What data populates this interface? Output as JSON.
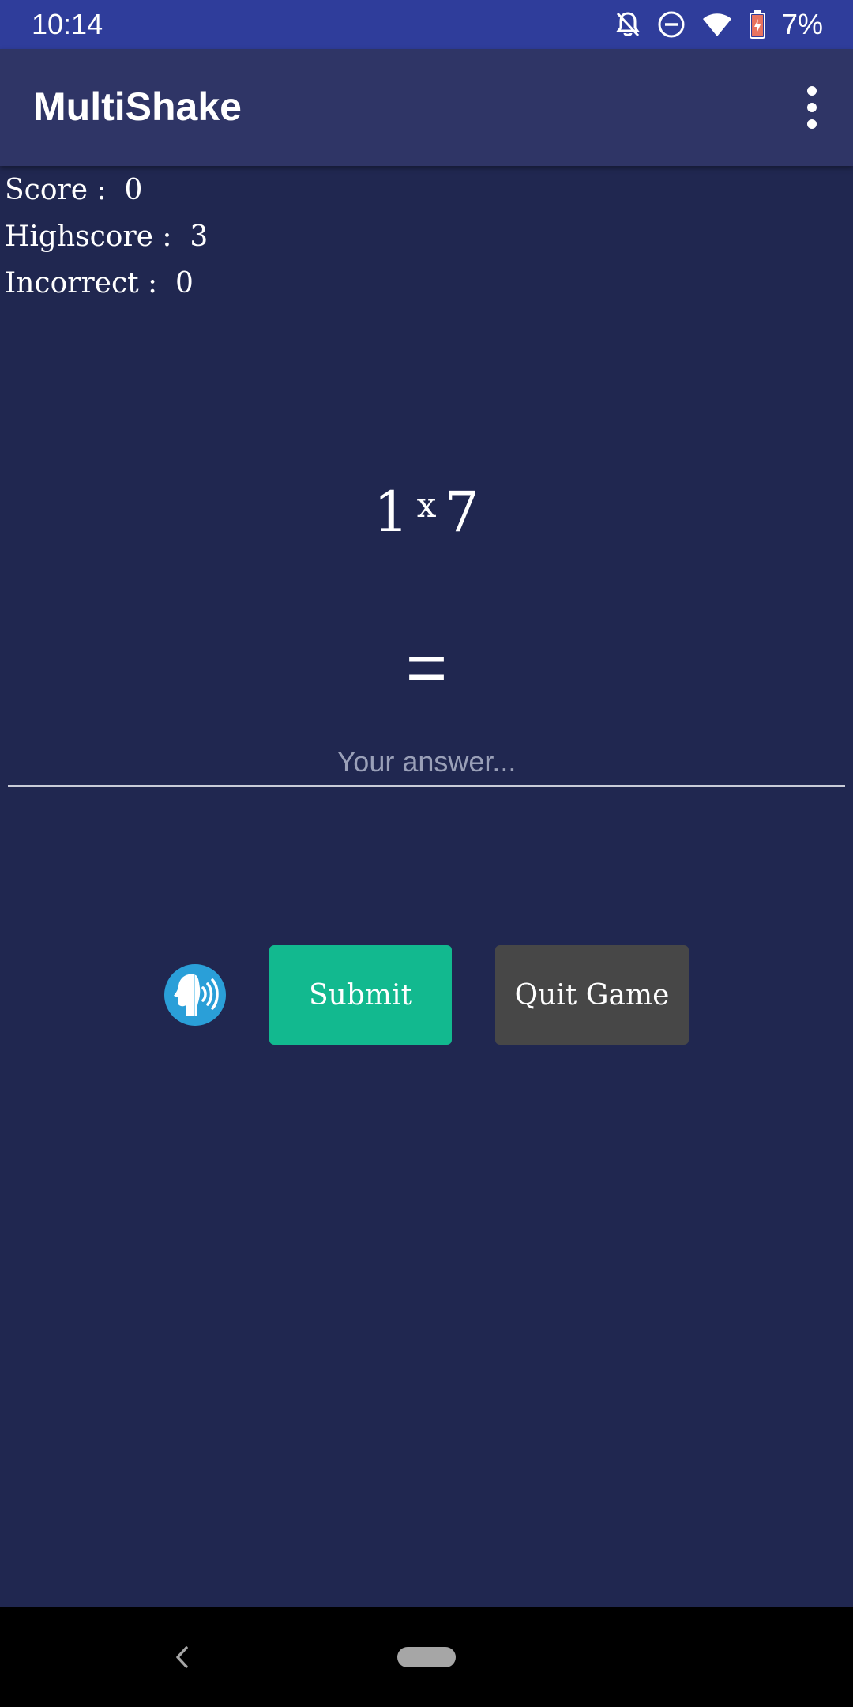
{
  "status_bar": {
    "time": "10:14",
    "battery_percent": "7%",
    "icons": [
      "notifications-off-icon",
      "do-not-disturb-icon",
      "wifi-icon",
      "battery-low-icon"
    ]
  },
  "app_bar": {
    "title": "MultiShake",
    "overflow_icon": "more-vert-icon"
  },
  "stats": {
    "score": "Score :  0",
    "highscore": "Highscore :  3",
    "incorrect": "Incorrect :  0"
  },
  "question": {
    "left_operand": "1",
    "operator": "x",
    "right_operand": "7",
    "equals": "="
  },
  "answer": {
    "value": "",
    "placeholder": "Your answer..."
  },
  "actions": {
    "voice_icon": "voice-input-icon",
    "submit_label": "Submit",
    "quit_label": "Quit Game"
  },
  "nav_bar": {
    "icons": [
      "back-icon",
      "home-pill-icon"
    ]
  },
  "colors": {
    "status_bar": "#2f3d9b",
    "app_bar": "#2f3566",
    "background": "#202750",
    "submit": "#12b98f",
    "quit": "#474747",
    "voice": "#2a9fd8"
  }
}
